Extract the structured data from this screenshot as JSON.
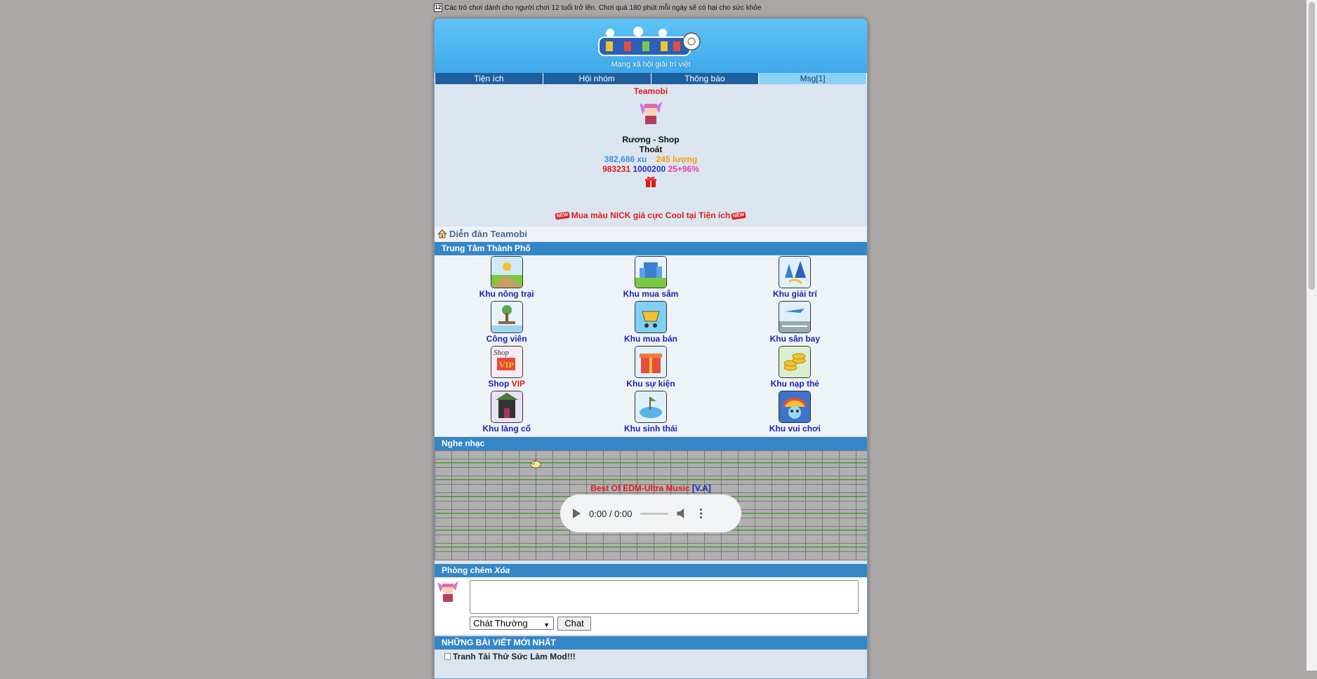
{
  "notice": {
    "tag": "12",
    "text": "Các trò chơi dành cho người chơi 12 tuổi trở lên. Chơi quá 180 phút mỗi ngày sẽ có hại cho sức khỏe"
  },
  "header": {
    "slogan": "Mạng xã hội giải trí việt"
  },
  "nav": [
    {
      "label": "Tiện ích"
    },
    {
      "label": "Hội nhóm"
    },
    {
      "label": "Thông báo"
    },
    {
      "label": "Msg[1]"
    }
  ],
  "profile": {
    "name": "Teamobi",
    "chest_shop": "Rương - Shop",
    "logout": "Thoát",
    "xu": "382,686 xu",
    "luong": "245 lượng",
    "stat_red": "983231",
    "stat_blue": "1000200",
    "stat_pink": "25+96%"
  },
  "promo": {
    "new_tag": "NEW",
    "text": "Mua màu NICK giá cực Cool tại Tiện ích"
  },
  "forum": {
    "title": "Diễn đàn Teamobi"
  },
  "city": {
    "title": "Trung Tâm Thành Phố",
    "zones": [
      {
        "label": "Khu nông trại",
        "icon": "farm-icon"
      },
      {
        "label": "Khu mua sắm",
        "icon": "shopping-icon"
      },
      {
        "label": "Khu giải trí",
        "icon": "entertainment-icon"
      },
      {
        "label": "Công viên",
        "icon": "park-icon"
      },
      {
        "label": "Khu mua bán",
        "icon": "trade-icon"
      },
      {
        "label": "Khu sân bay",
        "icon": "airport-icon"
      },
      {
        "label": "Shop ",
        "label_vip": "VIP",
        "icon": "vip-shop-icon"
      },
      {
        "label": "Khu sự kiện",
        "icon": "event-icon"
      },
      {
        "label": "Khu nạp thẻ",
        "icon": "topup-icon"
      },
      {
        "label": "Khu làng cổ",
        "icon": "old-village-icon"
      },
      {
        "label": "Khu sinh thái",
        "icon": "ecology-icon"
      },
      {
        "label": "Khu vui chơi",
        "icon": "playground-icon"
      }
    ]
  },
  "music": {
    "title": "Nghe nhạc",
    "song": "Best Of EDM-Ultra Music ",
    "artist": "[V.A]",
    "time": "0:00 / 0:00"
  },
  "chat": {
    "title": "Phòng chém ",
    "delete": "Xóa",
    "mode": "Chát Thường",
    "button": "Chat"
  },
  "posts": {
    "title": "NHỮNG BÀI VIẾT MỚI NHẤT",
    "items": [
      "Tranh Tài Thử Sức Làm Mod!!!"
    ]
  },
  "colors": {
    "header": "#5ec4f6",
    "nav": "#1e5f9e",
    "section": "#3586c6",
    "link": "#1d22b4",
    "red": "#e21c1c"
  }
}
